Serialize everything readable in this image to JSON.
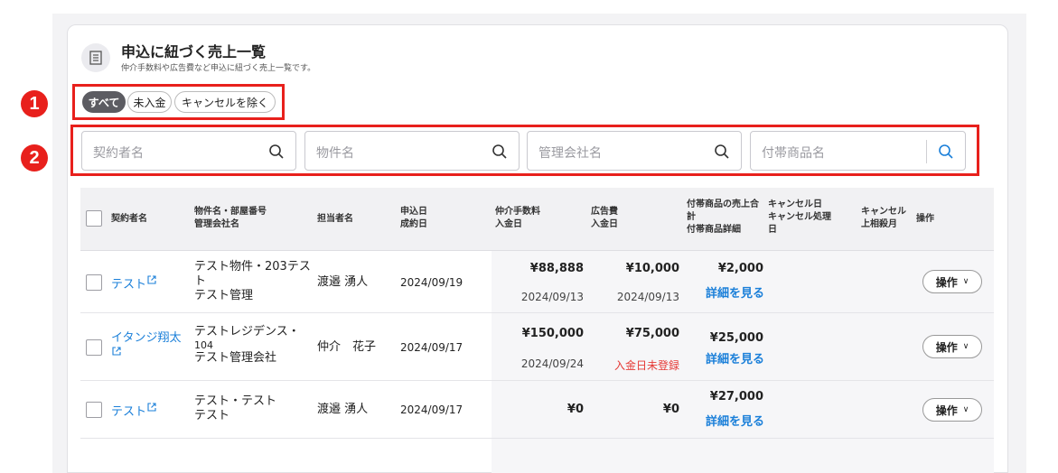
{
  "header": {
    "title": "申込に紐づく売上一覧",
    "subtitle": "仲介手数料や広告費など申込に紐づく売上一覧です。"
  },
  "annotations": [
    "1",
    "2"
  ],
  "filters": [
    {
      "label": "すべて",
      "active": true
    },
    {
      "label": "未入金",
      "active": false
    },
    {
      "label": "キャンセルを除く",
      "active": false
    }
  ],
  "search": [
    {
      "placeholder": "契約者名"
    },
    {
      "placeholder": "物件名"
    },
    {
      "placeholder": "管理会社名"
    },
    {
      "placeholder": "付帯商品名"
    }
  ],
  "table": {
    "headers": {
      "contractor": "契約者名",
      "property": [
        "物件名・部屋番号",
        "管理会社名"
      ],
      "staff": "担当者名",
      "dates": [
        "申込日",
        "成約日"
      ],
      "fee": [
        "仲介手数料",
        "入金日"
      ],
      "ad": [
        "広告費",
        "入金日"
      ],
      "goods": [
        "付帯商品の売上合",
        "計",
        "付帯商品詳細"
      ],
      "cancel": [
        "キャンセル日",
        "キャンセル処理",
        "日"
      ],
      "cancel_month": [
        "キャンセル",
        "上相殺月"
      ],
      "action": "操作"
    },
    "rows": [
      {
        "contractor": "テスト",
        "property": [
          "テスト物件・203テス",
          "ト",
          "テスト管理"
        ],
        "staff": "渡邉 湧人",
        "apply_date": "2024/09/19",
        "fee": "¥88,888",
        "fee_paid": "2024/09/13",
        "ad": "¥10,000",
        "ad_paid": "2024/09/13",
        "goods_total": "¥2,000",
        "detail": "詳細を見る",
        "action": "操作"
      },
      {
        "contractor": [
          "イタンジ翔太",
          ""
        ],
        "property": [
          "テストレジデンス・",
          "104",
          "テスト管理会社"
        ],
        "staff": "仲介　花子",
        "apply_date": "2024/09/17",
        "fee": "¥150,000",
        "fee_paid": "2024/09/24",
        "ad": "¥75,000",
        "ad_paid": "入金日未登録",
        "goods_total": "¥25,000",
        "detail": "詳細を見る",
        "action": "操作"
      },
      {
        "contractor": "テスト",
        "property": [
          "テスト・テスト",
          "テスト"
        ],
        "staff": "渡邉 湧人",
        "apply_date": "2024/09/17",
        "fee": "¥0",
        "ad": "¥0",
        "goods_total": "¥27,000",
        "detail": "詳細を見る",
        "action": "操作"
      }
    ]
  },
  "colors": {
    "accent": "#1a7fd9",
    "annotation_red": "#e8201c",
    "warning_red": "#e53935",
    "active_chip": "#5c5c62"
  }
}
